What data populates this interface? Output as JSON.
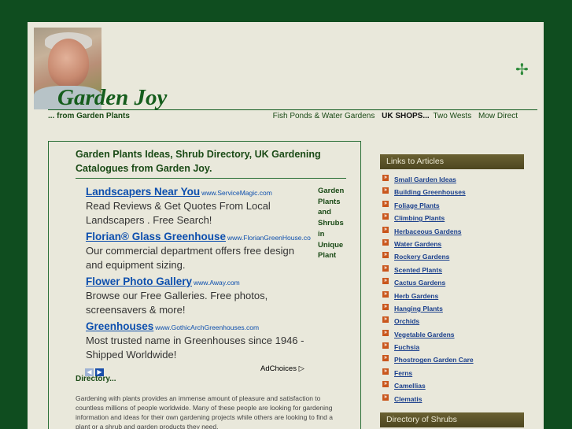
{
  "header": {
    "title": "Garden Joy",
    "tagline": "... from Garden Plants",
    "nav": [
      "Fish Ponds & Water Gardens",
      "UK SHOPS...",
      "Two Wests",
      "Mow Direct"
    ]
  },
  "main": {
    "heading": "Garden Plants Ideas, Shrub Directory, UK Gardening Catalogues from Garden Joy.",
    "ads": [
      {
        "title": "Landscapers Near You",
        "url": "www.ServiceMagic.com",
        "desc": "Read Reviews & Get Quotes From Local Landscapers . Free Search!"
      },
      {
        "title": "Florian® Glass Greenhouse",
        "url": "www.FlorianGreenHouse.co",
        "desc": "Our commercial department offers free design and equipment sizing."
      },
      {
        "title": "Flower Photo Gallery",
        "url": "www.Away.com",
        "desc": "Browse our Free Galleries. Free photos, screensavers & more!"
      },
      {
        "title": "Greenhouses",
        "url": "www.GothicArchGreenhouses.com",
        "desc": "Most trusted name in Greenhouses since 1946 - Shipped Worldwide!"
      }
    ],
    "side_text": "Garden Plants and Shrubs in Unique Plant",
    "adchoices": "AdChoices",
    "directory_label": "Directory...",
    "body_text": "Gardening with plants provides an immense amount of pleasure and satisfaction to countless millions of people worldwide. Many of these people are looking for gardening information and ideas for their own gardening projects while others are looking to find a plant or a shrub and garden products they need."
  },
  "sidebar": {
    "articles_header": "Links to Articles",
    "articles": [
      "Small Garden Ideas",
      "Building Greenhouses",
      "Foliage Plants",
      "Climbing Plants",
      "Herbaceous Gardens",
      "Water Gardens",
      "Rockery Gardens",
      "Scented Plants",
      "Cactus Gardens",
      "Herb Gardens",
      "Hanging Plants",
      "Orchids",
      "Vegetable Gardens",
      "Fuchsia",
      "Phostrogen Garden Care",
      "Ferns",
      "Camellias",
      "Clematis"
    ],
    "shrubs_header": "Directory of Shrubs"
  },
  "colors": {
    "background": "#0f4d1f",
    "page": "#e9e8db",
    "brand": "#155d1c",
    "link": "#0d4fae"
  }
}
